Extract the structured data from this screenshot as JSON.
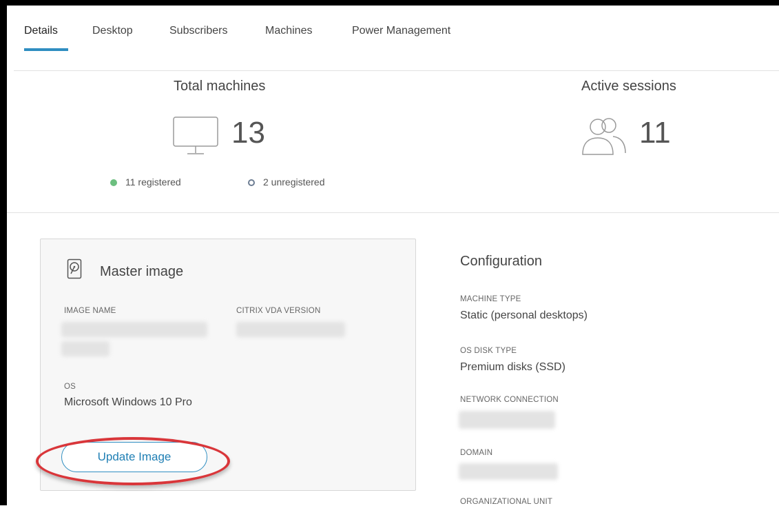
{
  "tabs": [
    {
      "label": "Details",
      "active": true
    },
    {
      "label": "Desktop"
    },
    {
      "label": "Subscribers"
    },
    {
      "label": "Machines"
    },
    {
      "label": "Power Management"
    }
  ],
  "stats": {
    "total_machines": {
      "title": "Total machines",
      "value": "13",
      "icon": "monitor-icon",
      "registered": "11 registered",
      "unregistered": "2 unregistered"
    },
    "active_sessions": {
      "title": "Active sessions",
      "value": "11",
      "icon": "users-icon"
    }
  },
  "master_image": {
    "title": "Master image",
    "icon": "disk-image-icon",
    "image_name_label": "IMAGE NAME",
    "vda_version_label": "CITRIX VDA VERSION",
    "os_label": "OS",
    "os_value": "Microsoft Windows 10 Pro",
    "update_button": "Update Image"
  },
  "configuration": {
    "title": "Configuration",
    "machine_type_label": "MACHINE TYPE",
    "machine_type_value": "Static (personal desktops)",
    "os_disk_type_label": "OS DISK TYPE",
    "os_disk_type_value": "Premium disks (SSD)",
    "network_connection_label": "NETWORK CONNECTION",
    "domain_label": "DOMAIN",
    "organizational_unit_label": "ORGANIZATIONAL UNIT"
  },
  "colors": {
    "accent": "#2f8ec1",
    "registered": "#6cbf7f",
    "unregistered": "#6d7d93",
    "highlight": "#d9363a"
  }
}
